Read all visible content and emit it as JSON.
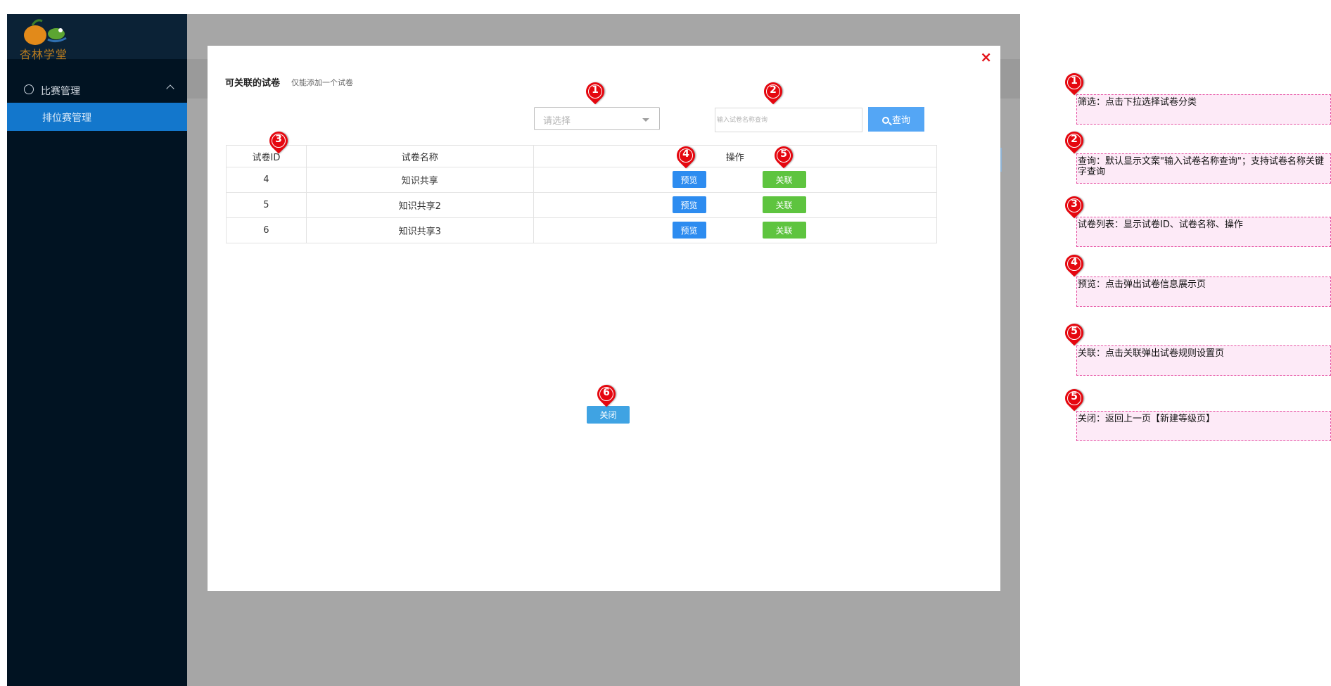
{
  "sidebar": {
    "logo_text": "杏林学堂",
    "group_label": "比赛管理",
    "active_item": "排位赛管理"
  },
  "modal": {
    "close_symbol": "×",
    "title": "可关联的试卷",
    "subtitle": "仅能添加一个试卷",
    "filter_placeholder": "请选择",
    "search_placeholder": "输入试卷名称查询",
    "query_label": "查询",
    "columns": [
      "试卷ID",
      "试卷名称",
      "操作"
    ],
    "rows": [
      {
        "id": "4",
        "name": "知识共享"
      },
      {
        "id": "5",
        "name": "知识共享2"
      },
      {
        "id": "6",
        "name": "知识共享3"
      }
    ],
    "preview_label": "预览",
    "link_label": "关联",
    "close_label": "关闭"
  },
  "markers": [
    "1",
    "2",
    "3",
    "4",
    "5",
    "6",
    "1",
    "2",
    "3",
    "4",
    "5",
    "5"
  ],
  "notes": [
    "筛选：点击下拉选择试卷分类",
    "查询：默认显示文案\"输入试卷名称查询\"；支持试卷名称关键字查询",
    "试卷列表：显示试卷ID、试卷名称、操作",
    "预览：点击弹出试卷信息展示页",
    "关联：点击关联弹出试卷规则设置页",
    "关闭：返回上一页【新建等级页】"
  ],
  "colors": {
    "sidebar_bg": "#011322",
    "active_nav": "#1377cc",
    "overlay": "#a6a6a6",
    "preview_btn": "#2d8cf0",
    "link_btn": "#5ec43f",
    "marker": "#e5070f",
    "note_bg": "#fdeaf7",
    "note_border": "#e54fa2"
  }
}
